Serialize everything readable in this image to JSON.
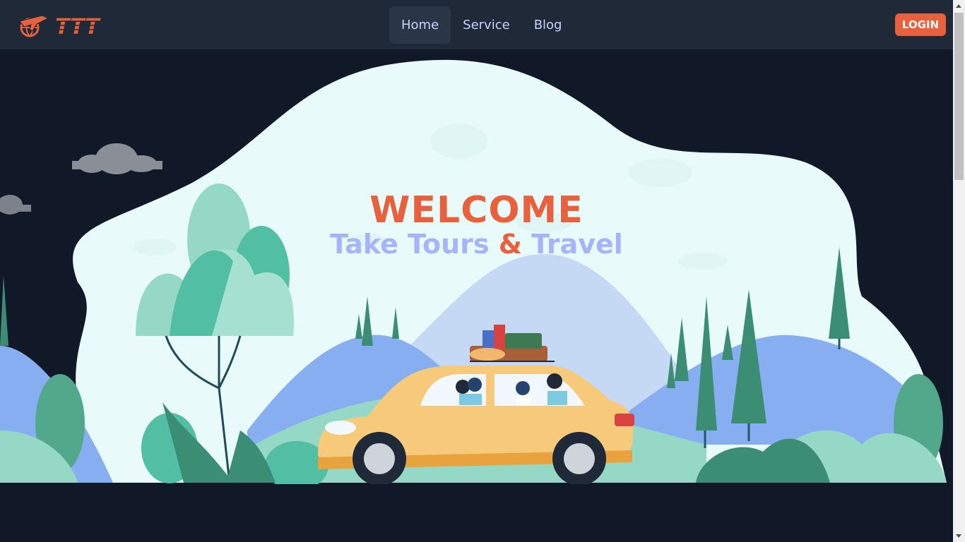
{
  "navbar": {
    "logo_icon": "globe-plane-icon",
    "logo_text": "TTT",
    "links": [
      {
        "label": "Home",
        "active": true
      },
      {
        "label": "Service",
        "active": false
      },
      {
        "label": "Blog",
        "active": false
      }
    ],
    "login_label": "LOGIN"
  },
  "hero": {
    "welcome": "WELCOME",
    "tagline_part1": "Take Tours",
    "tagline_amp": "&",
    "tagline_part2": "Travel",
    "illustration": "family-road-trip-car-illustration"
  },
  "colors": {
    "accent": "#e8613c",
    "nav_bg": "#1f2937",
    "page_bg": "#111827",
    "link": "#c7d2fe",
    "tagline": "#a5b4fc",
    "blob": "#e8fbfa"
  }
}
